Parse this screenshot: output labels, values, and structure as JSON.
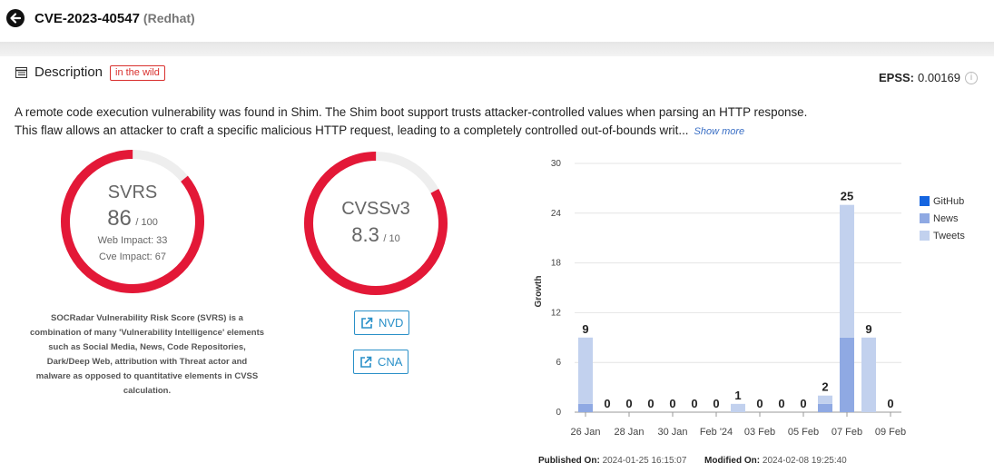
{
  "header": {
    "cve_id": "CVE-2023-40547",
    "vendor": "(Redhat)"
  },
  "description": {
    "title": "Description",
    "badge": "in the wild",
    "epss_label": "EPSS:",
    "epss_value": "0.00169",
    "text": "A remote code execution vulnerability was found in Shim. The Shim boot support trusts attacker-controlled values when parsing an HTTP response. This flaw allows an attacker to craft a specific malicious HTTP request, leading to a completely controlled out-of-bounds writ...",
    "show_more": "Show more"
  },
  "svrs": {
    "label": "SVRS",
    "score": "86",
    "max": "/ 100",
    "score_value": 86,
    "web_impact": "Web Impact: 33",
    "cve_impact": "Cve Impact: 67",
    "description": "SOCRadar Vulnerability Risk Score (SVRS) is a combination of many 'Vulnerability Intelligence' elements such as Social Media, News, Code Repositories, Dark/Deep Web, attribution with Threat actor and malware as opposed to quantitative elements in CVSS calculation."
  },
  "cvss": {
    "label": "CVSSv3",
    "score": "8.3",
    "max": "/ 10",
    "score_value": 8.3
  },
  "links": {
    "nvd": "NVD",
    "cna": "CNA"
  },
  "colors": {
    "gauge": "#e31837",
    "gauge_track": "#eeeeee",
    "github": "#1565e0",
    "news": "#8fa9e3",
    "tweets": "#c2d1ee",
    "link": "#2a90c8"
  },
  "chart_data": {
    "type": "bar",
    "stacked": true,
    "ylabel": "Growth",
    "ylim": [
      0,
      30
    ],
    "yticks": [
      0,
      6,
      12,
      18,
      24,
      30
    ],
    "x_labels": [
      "26 Jan",
      "28 Jan",
      "30 Jan",
      "Feb '24",
      "03 Feb",
      "05 Feb",
      "07 Feb",
      "09 Feb"
    ],
    "categories": [
      "2024-01-26",
      "2024-01-27",
      "2024-01-28",
      "2024-01-29",
      "2024-01-30",
      "2024-01-31",
      "2024-02-01",
      "2024-02-02",
      "2024-02-03",
      "2024-02-04",
      "2024-02-05",
      "2024-02-06",
      "2024-02-07",
      "2024-02-08",
      "2024-02-09"
    ],
    "totals": [
      9,
      0,
      0,
      0,
      0,
      0,
      0,
      1,
      0,
      0,
      0,
      2,
      25,
      9,
      0
    ],
    "series": [
      {
        "name": "GitHub",
        "values": [
          0,
          0,
          0,
          0,
          0,
          0,
          0,
          0,
          0,
          0,
          0,
          0,
          0,
          0,
          0
        ]
      },
      {
        "name": "News",
        "values": [
          1,
          0,
          0,
          0,
          0,
          0,
          0,
          0,
          0,
          0,
          0,
          1,
          9,
          0,
          0
        ]
      },
      {
        "name": "Tweets",
        "values": [
          8,
          0,
          0,
          0,
          0,
          0,
          0,
          1,
          0,
          0,
          0,
          1,
          16,
          9,
          0
        ]
      }
    ],
    "grid": true,
    "legend": "right"
  },
  "meta": {
    "published_label": "Published On:",
    "published_value": "2024-01-25 16:15:07",
    "modified_label": "Modified On:",
    "modified_value": "2024-02-08 19:25:40"
  }
}
